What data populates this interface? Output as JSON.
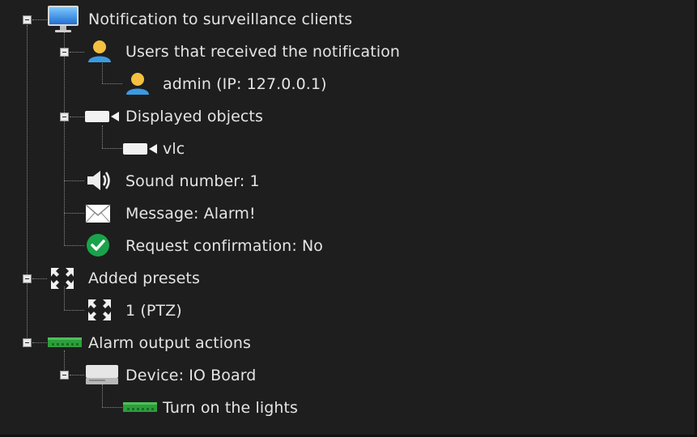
{
  "tree": {
    "nodes": [
      {
        "id": "notification",
        "label": "Notification to surveillance clients",
        "icon": "monitor-icon",
        "expanded": true
      },
      {
        "id": "users-received",
        "label": "Users that received the notification",
        "icon": "user-icon",
        "expanded": true
      },
      {
        "id": "user-admin",
        "label": "admin (IP: 127.0.0.1)",
        "icon": "user-icon"
      },
      {
        "id": "displayed-objects",
        "label": "Displayed objects",
        "icon": "camera-icon",
        "expanded": true
      },
      {
        "id": "object-vlc",
        "label": "vlc",
        "icon": "camera-icon"
      },
      {
        "id": "sound-number",
        "label": "Sound number: 1",
        "icon": "speaker-icon"
      },
      {
        "id": "message",
        "label": "Message: Alarm!",
        "icon": "envelope-icon"
      },
      {
        "id": "request-confirmation",
        "label": "Request confirmation: No",
        "icon": "check-circle-icon"
      },
      {
        "id": "added-presets",
        "label": "Added presets",
        "icon": "ptz-arrows-icon",
        "expanded": true
      },
      {
        "id": "preset-1",
        "label": "1 (PTZ)",
        "icon": "ptz-arrows-icon"
      },
      {
        "id": "alarm-output-actions",
        "label": "Alarm output actions",
        "icon": "io-board-icon",
        "expanded": true
      },
      {
        "id": "device-io-board",
        "label": "Device: IO Board",
        "icon": "device-icon",
        "expanded": true
      },
      {
        "id": "turn-on-lights",
        "label": "Turn on the lights",
        "icon": "io-board-icon"
      }
    ]
  },
  "colors": {
    "background": "#1e1e1e",
    "text": "#e4e4e4",
    "connector": "#8a8a8a",
    "user_accent": "#3a9be0",
    "check_green": "#1aa34a",
    "board_green": "#2e9e3c"
  }
}
